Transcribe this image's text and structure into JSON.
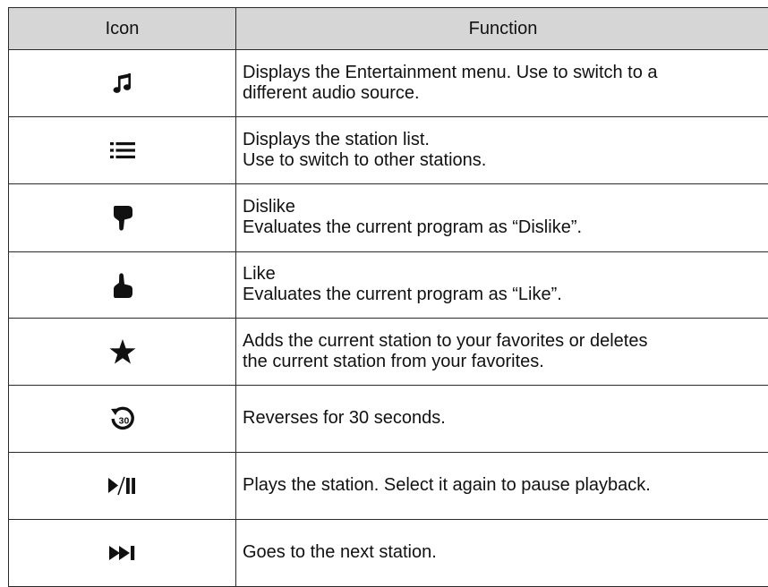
{
  "table": {
    "headers": {
      "icon": "Icon",
      "function": "Function"
    },
    "rows": [
      {
        "icon": "music-note-icon",
        "lines": [
          "Displays the Entertainment menu. Use to switch to a",
          "different audio source."
        ]
      },
      {
        "icon": "list-icon",
        "lines": [
          "Displays the station list.",
          "Use to switch to other stations."
        ]
      },
      {
        "icon": "thumbs-down-icon",
        "lines": [
          "Dislike",
          "Evaluates the current program as “Dislike”."
        ]
      },
      {
        "icon": "thumbs-up-icon",
        "lines": [
          "Like",
          "Evaluates the current program as “Like”."
        ]
      },
      {
        "icon": "star-icon",
        "lines": [
          "Adds the current station to your favorites or deletes",
          "the current station from your favorites."
        ]
      },
      {
        "icon": "rewind-30-icon",
        "icon_text": "30",
        "lines": [
          "Reverses for 30 seconds."
        ]
      },
      {
        "icon": "play-pause-icon",
        "lines": [
          "Plays the station. Select it again to pause playback."
        ]
      },
      {
        "icon": "skip-next-icon",
        "lines": [
          "Goes to the next station."
        ]
      }
    ]
  },
  "colors": {
    "header_background": "#d6d6d6",
    "border": "#2a2a2a",
    "text": "#111111"
  }
}
